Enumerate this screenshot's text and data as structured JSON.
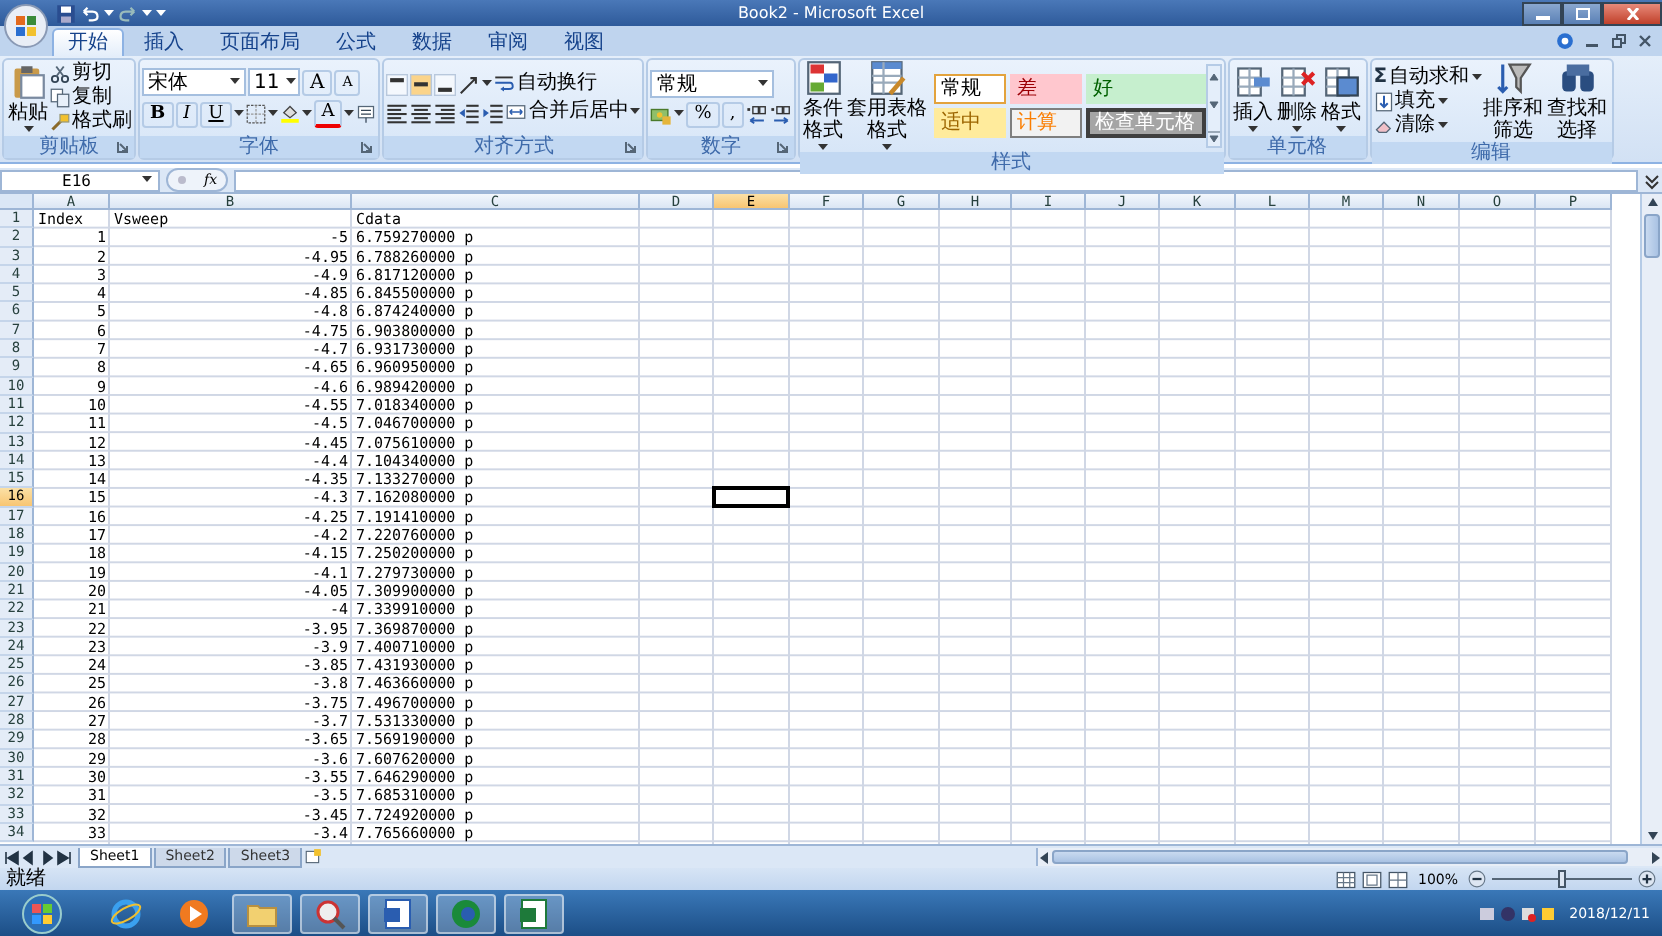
{
  "title_bar": {
    "title": "Book2 - Microsoft Excel"
  },
  "ribbon_tabs": [
    {
      "label": "开始",
      "selected": true
    },
    {
      "label": "插入",
      "selected": false
    },
    {
      "label": "页面布局",
      "selected": false
    },
    {
      "label": "公式",
      "selected": false
    },
    {
      "label": "数据",
      "selected": false
    },
    {
      "label": "审阅",
      "selected": false
    },
    {
      "label": "视图",
      "selected": false
    }
  ],
  "ribbon": {
    "clipboard": {
      "label": "剪贴板",
      "paste": "粘贴",
      "cut": "剪切",
      "copy": "复制",
      "format_painter": "格式刷"
    },
    "font": {
      "label": "字体",
      "font_name": "宋体",
      "font_size": "11",
      "grow": "A",
      "shrink": "A",
      "bold": "B",
      "italic": "I",
      "underline": "U",
      "font_color": "A"
    },
    "alignment": {
      "label": "对齐方式",
      "wrap_text": "自动换行",
      "merge_center": "合并后居中"
    },
    "number": {
      "label": "数字",
      "format": "常规",
      "percent": "%",
      "comma": ","
    },
    "styles": {
      "label": "样式",
      "conditional_formatting": "条件格式",
      "format_as_table": "套用表格格式",
      "cell_styles": [
        {
          "label": "常规",
          "kind": "normal"
        },
        {
          "label": "差",
          "kind": "bad"
        },
        {
          "label": "好",
          "kind": "good"
        },
        {
          "label": "适中",
          "kind": "neutral"
        },
        {
          "label": "计算",
          "kind": "calculation"
        },
        {
          "label": "检查单元格",
          "kind": "check"
        }
      ]
    },
    "cells": {
      "label": "单元格",
      "insert": "插入",
      "delete": "删除",
      "format": "格式"
    },
    "editing": {
      "label": "编辑",
      "autosum_symbol": "Σ",
      "autosum": "自动求和",
      "fill": "填充",
      "clear": "清除",
      "sort_filter": "排序和筛选",
      "find_select": "查找和选择"
    }
  },
  "formula_bar": {
    "name_box": "E16",
    "fx": "fx"
  },
  "columns": [
    {
      "label": "A",
      "selected": false
    },
    {
      "label": "B",
      "selected": false
    },
    {
      "label": "C",
      "selected": false
    },
    {
      "label": "D",
      "selected": false
    },
    {
      "label": "E",
      "selected": true
    },
    {
      "label": "F",
      "selected": false
    },
    {
      "label": "G",
      "selected": false
    },
    {
      "label": "H",
      "selected": false
    },
    {
      "label": "I",
      "selected": false
    },
    {
      "label": "J",
      "selected": false
    },
    {
      "label": "K",
      "selected": false
    },
    {
      "label": "L",
      "selected": false
    },
    {
      "label": "M",
      "selected": false
    },
    {
      "label": "N",
      "selected": false
    },
    {
      "label": "O",
      "selected": false
    },
    {
      "label": "P",
      "selected": false
    }
  ],
  "rows": [
    {
      "number": "1",
      "selected": false,
      "cells": [
        "Index",
        "Vsweep",
        "Cdata"
      ]
    },
    {
      "number": "2",
      "selected": false,
      "cells": [
        "1",
        "-5",
        "6.759270000 p"
      ]
    },
    {
      "number": "3",
      "selected": false,
      "cells": [
        "2",
        "-4.95",
        "6.788260000 p"
      ]
    },
    {
      "number": "4",
      "selected": false,
      "cells": [
        "3",
        "-4.9",
        "6.817120000 p"
      ]
    },
    {
      "number": "5",
      "selected": false,
      "cells": [
        "4",
        "-4.85",
        "6.845500000 p"
      ]
    },
    {
      "number": "6",
      "selected": false,
      "cells": [
        "5",
        "-4.8",
        "6.874240000 p"
      ]
    },
    {
      "number": "7",
      "selected": false,
      "cells": [
        "6",
        "-4.75",
        "6.903800000 p"
      ]
    },
    {
      "number": "8",
      "selected": false,
      "cells": [
        "7",
        "-4.7",
        "6.931730000 p"
      ]
    },
    {
      "number": "9",
      "selected": false,
      "cells": [
        "8",
        "-4.65",
        "6.960950000 p"
      ]
    },
    {
      "number": "10",
      "selected": false,
      "cells": [
        "9",
        "-4.6",
        "6.989420000 p"
      ]
    },
    {
      "number": "11",
      "selected": false,
      "cells": [
        "10",
        "-4.55",
        "7.018340000 p"
      ]
    },
    {
      "number": "12",
      "selected": false,
      "cells": [
        "11",
        "-4.5",
        "7.046700000 p"
      ]
    },
    {
      "number": "13",
      "selected": false,
      "cells": [
        "12",
        "-4.45",
        "7.075610000 p"
      ]
    },
    {
      "number": "14",
      "selected": false,
      "cells": [
        "13",
        "-4.4",
        "7.104340000 p"
      ]
    },
    {
      "number": "15",
      "selected": false,
      "cells": [
        "14",
        "-4.35",
        "7.133270000 p"
      ]
    },
    {
      "number": "16",
      "selected": true,
      "cells": [
        "15",
        "-4.3",
        "7.162080000 p"
      ]
    },
    {
      "number": "17",
      "selected": false,
      "cells": [
        "16",
        "-4.25",
        "7.191410000 p"
      ]
    },
    {
      "number": "18",
      "selected": false,
      "cells": [
        "17",
        "-4.2",
        "7.220760000 p"
      ]
    },
    {
      "number": "19",
      "selected": false,
      "cells": [
        "18",
        "-4.15",
        "7.250200000 p"
      ]
    },
    {
      "number": "20",
      "selected": false,
      "cells": [
        "19",
        "-4.1",
        "7.279730000 p"
      ]
    },
    {
      "number": "21",
      "selected": false,
      "cells": [
        "20",
        "-4.05",
        "7.309900000 p"
      ]
    },
    {
      "number": "22",
      "selected": false,
      "cells": [
        "21",
        "-4",
        "7.339910000 p"
      ]
    },
    {
      "number": "23",
      "selected": false,
      "cells": [
        "22",
        "-3.95",
        "7.369870000 p"
      ]
    },
    {
      "number": "24",
      "selected": false,
      "cells": [
        "23",
        "-3.9",
        "7.400710000 p"
      ]
    },
    {
      "number": "25",
      "selected": false,
      "cells": [
        "24",
        "-3.85",
        "7.431930000 p"
      ]
    },
    {
      "number": "26",
      "selected": false,
      "cells": [
        "25",
        "-3.8",
        "7.463660000 p"
      ]
    },
    {
      "number": "27",
      "selected": false,
      "cells": [
        "26",
        "-3.75",
        "7.496700000 p"
      ]
    },
    {
      "number": "28",
      "selected": false,
      "cells": [
        "27",
        "-3.7",
        "7.531330000 p"
      ]
    },
    {
      "number": "29",
      "selected": false,
      "cells": [
        "28",
        "-3.65",
        "7.569190000 p"
      ]
    },
    {
      "number": "30",
      "selected": false,
      "cells": [
        "29",
        "-3.6",
        "7.607620000 p"
      ]
    },
    {
      "number": "31",
      "selected": false,
      "cells": [
        "30",
        "-3.55",
        "7.646290000 p"
      ]
    },
    {
      "number": "32",
      "selected": false,
      "cells": [
        "31",
        "-3.5",
        "7.685310000 p"
      ]
    },
    {
      "number": "33",
      "selected": false,
      "cells": [
        "32",
        "-3.45",
        "7.724920000 p"
      ]
    },
    {
      "number": "34",
      "selected": false,
      "cells": [
        "33",
        "-3.4",
        "7.765660000 p"
      ]
    }
  ],
  "sheet_tabs": [
    {
      "label": "Sheet1",
      "selected": true
    },
    {
      "label": "Sheet2",
      "selected": false
    },
    {
      "label": "Sheet3",
      "selected": false
    }
  ],
  "status_bar": {
    "text": "就绪",
    "zoom": "100%",
    "zoom_slider": {
      "level": 0.5
    }
  },
  "taskbar": {
    "apps": [
      {
        "running": false
      },
      {
        "running": false
      },
      {
        "running": true
      },
      {
        "running": true
      },
      {
        "running": true
      },
      {
        "running": true
      },
      {
        "running": true
      }
    ],
    "date": "2018/12/11"
  }
}
